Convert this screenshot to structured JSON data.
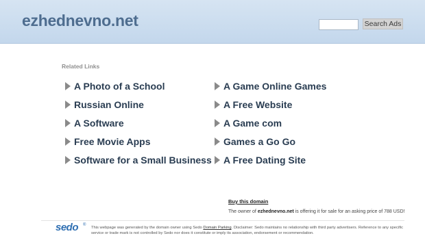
{
  "header": {
    "site_title": "ezhednevno.net",
    "search_placeholder": "",
    "search_button": "Search Ads"
  },
  "related": {
    "heading": "Related Links",
    "left": [
      "A Photo of a School",
      "Russian Online",
      "A Software",
      "Free Movie Apps",
      "Software for a Small Business"
    ],
    "right": [
      "A Game Online Games",
      "A Free Website",
      "A Game com",
      "Games a Go Go",
      "A Free Dating Site"
    ]
  },
  "sale": {
    "buy_link": "Buy this domain",
    "owner_prefix": "The owner of ",
    "owner_domain": "ezhednevno.net",
    "owner_suffix": " is offering it for sale for an asking price of 788 USD!"
  },
  "footer": {
    "logo": "sedo",
    "logo_mark": "®",
    "text_a": "This webpage was generated by the domain owner using Sedo ",
    "parking_link": "Domain Parking",
    "text_b": ". Disclaimer: Sedo maintains no relationship with third party advertisers. Reference to any specific service or trade mark is not controlled by Sedo nor does it constitute or imply its association, endorsement or recommendation."
  },
  "colors": {
    "header_bg": "#c9dcef",
    "title": "#4e6d8f",
    "link": "#2a3d52",
    "arrow": "#8a8a8a",
    "sedo_blue": "#2f6fb2"
  }
}
